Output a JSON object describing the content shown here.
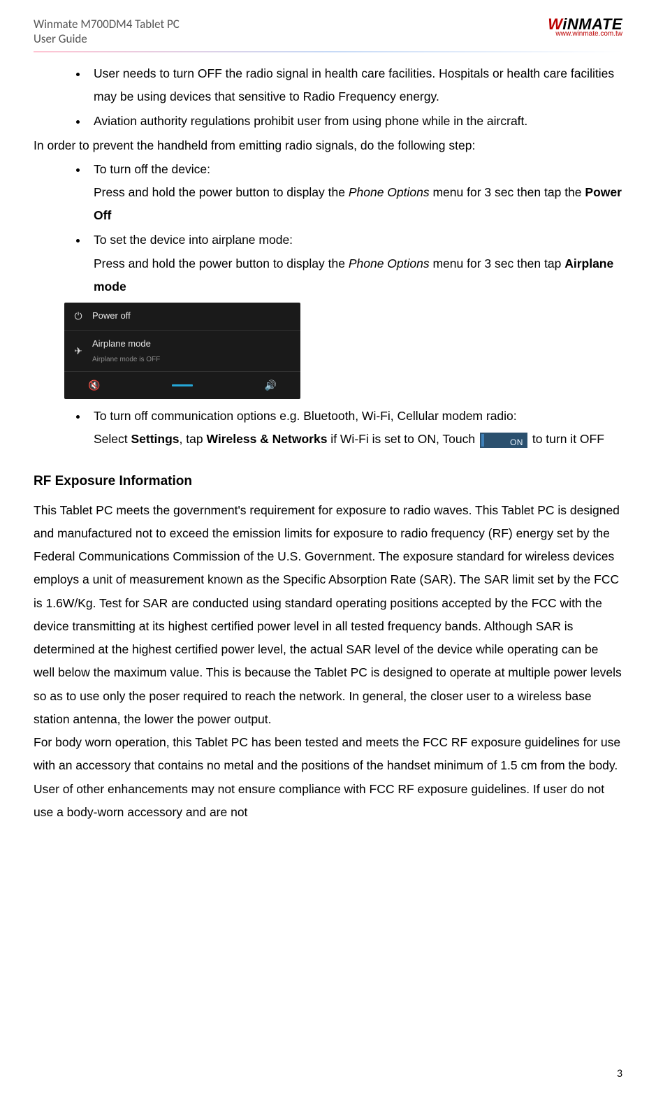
{
  "header": {
    "title_line1": "Winmate M700DM4 Tablet PC",
    "title_line2": "User Guide",
    "logo_text": "WiNMATE",
    "logo_url": "www.winmate.com.tw"
  },
  "bullets_top": [
    "User needs to turn OFF the radio signal in health care facilities. Hospitals or health care facilities may be using devices that sensitive to Radio Frequency energy.",
    "Aviation authority regulations prohibit user from using phone while in the aircraft."
  ],
  "intro_line": "In order to prevent the handheld from emitting radio signals, do the following step:",
  "steps": {
    "turn_off": {
      "title": "To turn off the device:",
      "line_a": "Press and hold the power button to display the ",
      "italic": "Phone Options",
      "line_b": " menu for 3 sec then tap the ",
      "bold": "Power Off"
    },
    "airplane": {
      "title": "To set the device into airplane mode:",
      "line_a": "Press and hold the power button to display the ",
      "italic": "Phone Options",
      "line_b": " menu for 3 sec then tap ",
      "bold": "Airplane mode"
    },
    "comm_off": {
      "title": "To turn off communication options e.g. Bluetooth, Wi-Fi, Cellular modem radio:",
      "line_a": "Select ",
      "bold_a": "Settings",
      "line_b": ", tap ",
      "bold_b": "Wireless & Networks",
      "line_c": "  if Wi-Fi is set to ON, Touch ",
      "toggle_label": "ON",
      "line_d": " to turn it OFF"
    }
  },
  "screenshot": {
    "row1": "Power off",
    "row2_title": "Airplane mode",
    "row2_sub": "Airplane mode is OFF"
  },
  "rf": {
    "heading": "RF Exposure Information",
    "para1": "This Tablet PC meets the government's requirement for exposure to radio waves. This Tablet PC is designed and manufactured not to exceed the emission limits for exposure to radio frequency (RF) energy set by the Federal Communications Commission of the U.S. Government. The exposure standard for wireless devices employs a unit of measurement known as the Specific Absorption Rate (SAR). The SAR limit set by the FCC is 1.6W/Kg. Test for SAR are conducted using standard operating positions accepted by the FCC with the device transmitting at its highest certified power level in all tested frequency bands. Although SAR is determined at the highest certified power level, the actual SAR level of the device while operating can be well below the maximum value. This is because the Tablet PC is designed to operate at multiple power levels so as to use only the poser required to reach the network. In general, the closer user to a wireless base station antenna, the lower the power output.",
    "para2": "For body worn operation, this Tablet PC has been tested and meets the FCC RF exposure guidelines for use with an accessory that contains no metal and the positions of the handset minimum of 1.5 cm from the body. User of other enhancements may not ensure compliance with FCC RF exposure guidelines. If user do not use a body-worn accessory and are not"
  },
  "page_number": "3"
}
